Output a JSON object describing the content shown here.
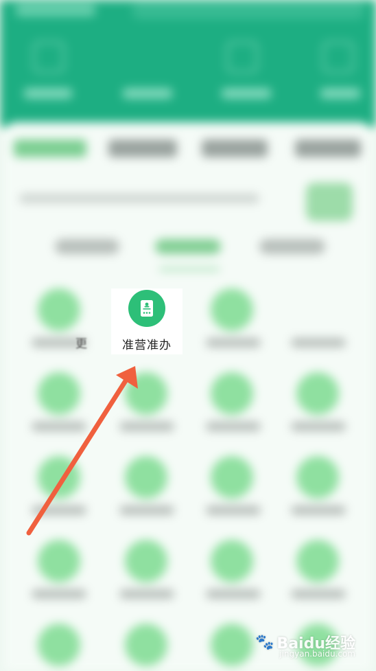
{
  "focus_item": {
    "label": "准营准办",
    "icon": "license-card-icon",
    "icon_color": "#2dbf78"
  },
  "partial_text": "更",
  "watermark": {
    "text": "Baidu经验",
    "sub": "jingyan.baidu.com"
  },
  "colors": {
    "header_green": "#1dae82",
    "arrow_red": "#f0603e"
  }
}
